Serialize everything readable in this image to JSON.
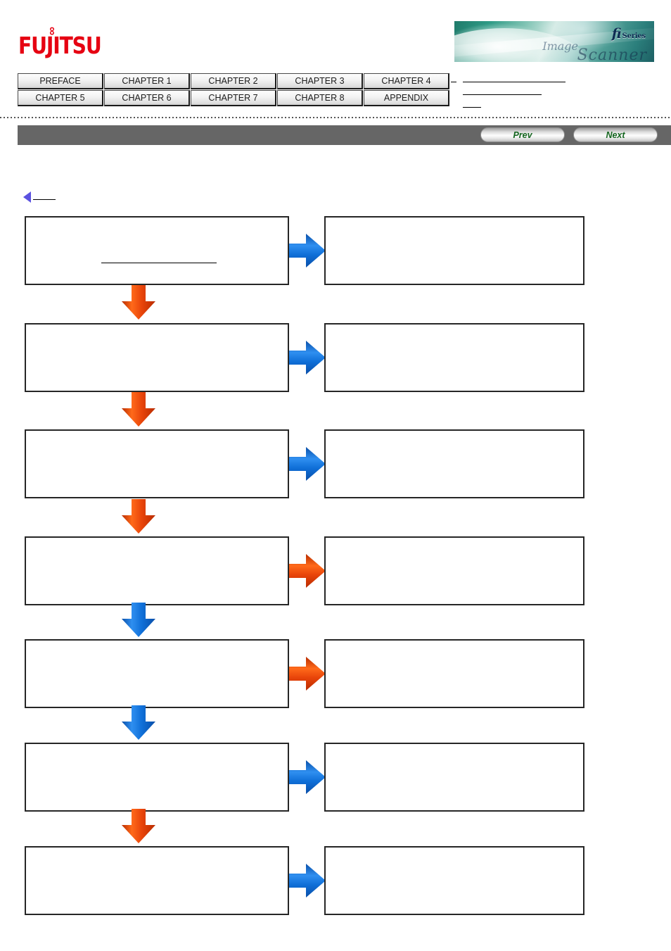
{
  "header": {
    "brand": "FUJITSU",
    "brand_mark": "∞",
    "banner": {
      "product_line": "fi",
      "series_label": "Series",
      "image_word": "Image",
      "scanner_word": "Scanner"
    }
  },
  "chapter_nav": {
    "row1": [
      {
        "label": "PREFACE"
      },
      {
        "label": "CHAPTER 1"
      },
      {
        "label": "CHAPTER 2"
      },
      {
        "label": "CHAPTER 3"
      },
      {
        "label": "CHAPTER 4"
      }
    ],
    "row2": [
      {
        "label": "CHAPTER 5"
      },
      {
        "label": "CHAPTER 6"
      },
      {
        "label": "CHAPTER 7"
      },
      {
        "label": "CHAPTER 8"
      },
      {
        "label": "APPENDIX"
      }
    ]
  },
  "toolbar": {
    "prev_label": "Prev",
    "next_label": "Next",
    "bar_color": "#666666"
  },
  "back_link": {
    "label": ""
  },
  "colors": {
    "brand_red": "#e60012",
    "arrow_blue": "#1479e0",
    "arrow_orange": "#ef4a0a",
    "back_triangle": "#5b52e0",
    "box_border": "#262626",
    "nav_bar": "#666666",
    "button_text_green": "#14661f"
  },
  "flow": {
    "rows": [
      {
        "left": {
          "text": "",
          "has_rule": true
        },
        "right": {
          "text": ""
        },
        "right_arrow_color": "blue",
        "down_arrow_color": "orange"
      },
      {
        "left": {
          "text": "",
          "has_rule": false
        },
        "right": {
          "text": ""
        },
        "right_arrow_color": "blue",
        "down_arrow_color": "orange"
      },
      {
        "left": {
          "text": "",
          "has_rule": false
        },
        "right": {
          "text": ""
        },
        "right_arrow_color": "blue",
        "down_arrow_color": "orange"
      },
      {
        "left": {
          "text": "",
          "has_rule": false
        },
        "right": {
          "text": ""
        },
        "right_arrow_color": "orange",
        "down_arrow_color": "blue"
      },
      {
        "left": {
          "text": "",
          "has_rule": false
        },
        "right": {
          "text": ""
        },
        "right_arrow_color": "orange",
        "down_arrow_color": "blue"
      },
      {
        "left": {
          "text": "",
          "has_rule": false
        },
        "right": {
          "text": ""
        },
        "right_arrow_color": "blue",
        "down_arrow_color": "orange"
      },
      {
        "left": {
          "text": "",
          "has_rule": false
        },
        "right": {
          "text": ""
        },
        "right_arrow_color": "blue",
        "down_arrow_color": null
      }
    ]
  }
}
